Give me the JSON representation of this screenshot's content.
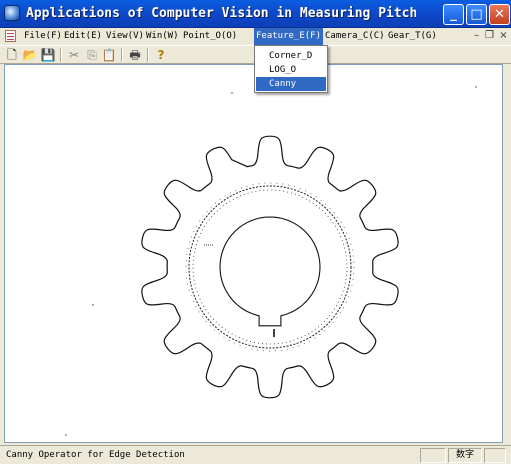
{
  "window": {
    "title": "Applications of Computer Vision in Measuring Pitch Deviation of..."
  },
  "menu": {
    "items": [
      "File(F)",
      "Edit(E)",
      "View(V)",
      "Win(W)",
      "Point_O(O)",
      "Feature_E(F)",
      "Camera_C(C)",
      "Gear_T(G)"
    ],
    "active_item": "Feature_E(F)"
  },
  "dropdown": {
    "items": [
      "Corner_D",
      "LOG_O",
      "Canny"
    ],
    "selected": "Canny"
  },
  "toolbar": {
    "icons": [
      "new-icon",
      "open-icon",
      "save-icon",
      "cut-icon",
      "copy-icon",
      "paste-icon",
      "print-icon",
      "help-icon"
    ]
  },
  "status": {
    "text": "Canny Operator for Edge Detection",
    "indicator": "数字"
  },
  "colors": {
    "title_bar": "#0e47c8",
    "menu_highlight": "#316ac5",
    "canvas": "#ffffff"
  },
  "content": {
    "image": "gear outline edge detection"
  }
}
